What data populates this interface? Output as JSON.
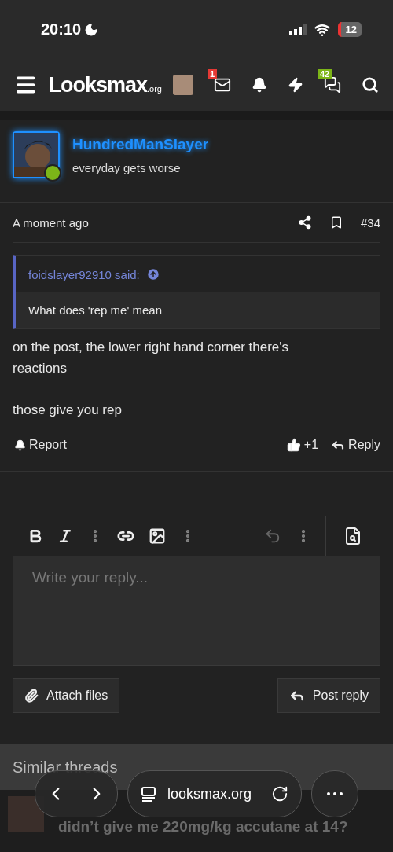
{
  "status_bar": {
    "time": "20:10",
    "battery": "12"
  },
  "header": {
    "logo": "Looksmax",
    "logo_suffix": ".org",
    "badges": [
      {
        "kind": "mail",
        "count": "1"
      },
      {
        "kind": "bell"
      },
      {
        "kind": "bolt"
      },
      {
        "kind": "chat",
        "count": "42"
      },
      {
        "kind": "search"
      }
    ]
  },
  "post": {
    "author": "HundredManSlayer",
    "user_title": "everyday gets worse",
    "online": true,
    "time": "A moment ago",
    "number": "#34",
    "quote": {
      "author": "foidslayer92910 said:",
      "text": "What does 'rep me' mean"
    },
    "paragraphs": [
      "on the post, the lower right hand corner there's reactions",
      "those give you rep"
    ],
    "actions": {
      "report": "Report",
      "reactions": "+1",
      "reply": "Reply"
    }
  },
  "editor": {
    "placeholder": "Write your reply...",
    "attach": "Attach files",
    "submit": "Post reply"
  },
  "similar": {
    "title": "Similar threads",
    "thread_line": "didn’t give me 220mg/kg accutane at 14?"
  },
  "browser": {
    "url": "looksmax.org"
  }
}
